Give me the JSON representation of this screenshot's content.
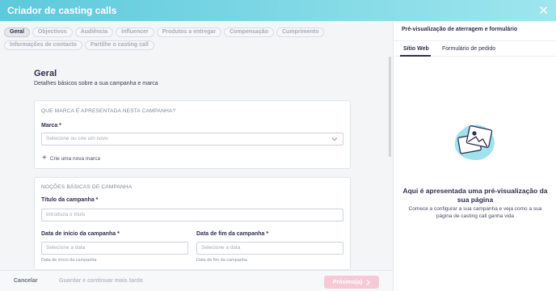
{
  "header": {
    "title": "Criador de casting calls",
    "close_icon": "close-icon"
  },
  "tabs": [
    {
      "label": "Geral",
      "active": true
    },
    {
      "label": "Objectivos"
    },
    {
      "label": "Audiência"
    },
    {
      "label": "Influencer"
    },
    {
      "label": "Produtos a entregar"
    },
    {
      "label": "Compensação"
    },
    {
      "label": "Cumprimento"
    },
    {
      "label": "Informações de contacto"
    },
    {
      "label": "Partilhe o casting call"
    }
  ],
  "section": {
    "title": "Geral",
    "subtitle": "Detalhes básicos sobre a sua campanha e marca"
  },
  "brand_card": {
    "caption": "QUE MARCA É APRESENTADA NESTA CAMPANHA?",
    "brand_label": "Marca *",
    "brand_placeholder": "Selecione ou crie um novo",
    "create_brand": "Crie uma nova marca"
  },
  "basics_card": {
    "caption": "NOÇÕES BÁSICAS DE CAMPANHA",
    "title_label": "Título da campanha *",
    "title_placeholder": "Introduza o título",
    "start_label": "Data de início da campanha *",
    "start_placeholder": "Selecione a data",
    "start_hint": "Data de início da campanha",
    "end_label": "Data de fim da campanha *",
    "end_placeholder": "Selecione a data",
    "end_hint": "Data de fim da campanha"
  },
  "footer": {
    "cancel": "Cancelar",
    "save": "Guardar e continuar mais tarde",
    "next": "Próximo(a)"
  },
  "preview": {
    "heading": "Pré-visualização de aterragem e formulário",
    "tabs": [
      {
        "label": "Sítio Web",
        "active": true
      },
      {
        "label": "Formulário de pedido"
      }
    ],
    "empty_title": "Aqui é apresentada uma pré-visualização da sua página",
    "empty_desc": "Comece a configurar a sua campanha e veja como a sua página de casting call ganha vida"
  },
  "colors": {
    "accent": "#5dc9dc",
    "next_button": "#f7c9d6",
    "text_dark": "#2e2e50"
  }
}
